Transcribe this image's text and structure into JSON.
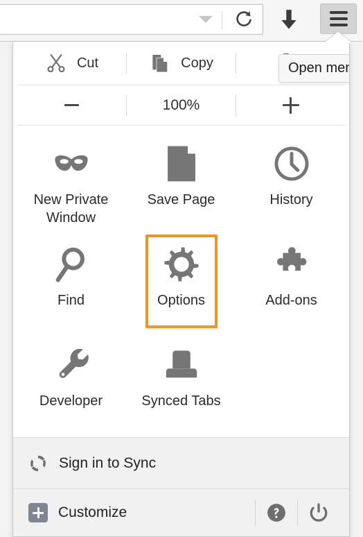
{
  "toolbar": {
    "urlbar": {
      "value": "",
      "placeholder": "",
      "dropdown_icon": "chevron-down-icon"
    },
    "reload_icon": "reload-icon",
    "downloads_icon": "download-arrow-icon",
    "menu_icon": "hamburger-menu-icon"
  },
  "tooltip": {
    "text": "Open menu"
  },
  "panel": {
    "edit_row": [
      {
        "label": "Cut",
        "icon": "scissors-icon"
      },
      {
        "label": "Copy",
        "icon": "copy-icon"
      },
      {
        "label": "",
        "icon": "paste-clipboard-icon"
      }
    ],
    "zoom_row": {
      "minus_label": "−",
      "level": "100%",
      "plus_label": "+"
    },
    "grid": [
      {
        "label": "New Private Window",
        "icon": "mask-icon",
        "selected": false
      },
      {
        "label": "Save Page",
        "icon": "document-icon",
        "selected": false
      },
      {
        "label": "History",
        "icon": "clock-icon",
        "selected": false
      },
      {
        "label": "Find",
        "icon": "magnifier-icon",
        "selected": false
      },
      {
        "label": "Options",
        "icon": "gear-icon",
        "selected": true
      },
      {
        "label": "Add-ons",
        "icon": "puzzle-piece-icon",
        "selected": false
      },
      {
        "label": "Developer",
        "icon": "wrench-icon",
        "selected": false
      },
      {
        "label": "Synced Tabs",
        "icon": "synced-tabs-icon",
        "selected": false
      },
      {
        "label": "",
        "icon": "",
        "selected": false
      }
    ],
    "sync": {
      "label": "Sign in to Sync",
      "icon": "sync-arrows-icon"
    },
    "footer": {
      "customize_label": "Customize",
      "customize_icon": "plus-square-icon",
      "help_icon": "question-mark-icon",
      "power_icon": "power-icon"
    }
  },
  "colors": {
    "highlight": "#F0951E",
    "icon_gray": "#767676",
    "panel_bg": "#ffffff",
    "strip_bg": "#f1f1f1"
  }
}
